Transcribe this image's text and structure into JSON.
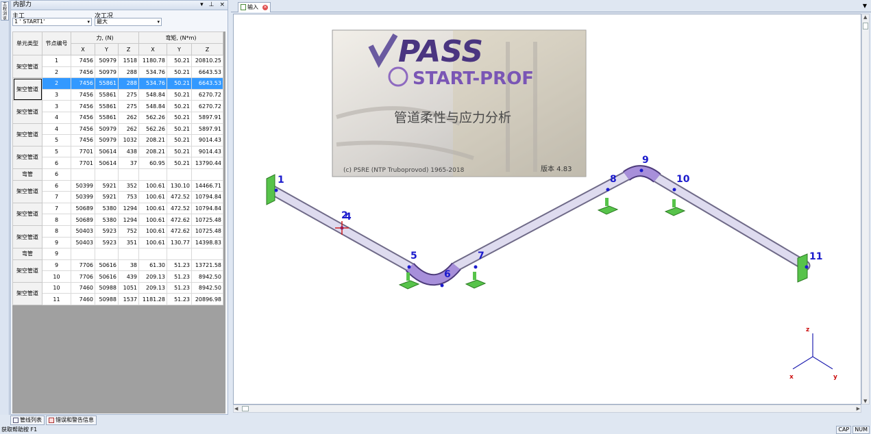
{
  "left_panel": {
    "title": "内部力",
    "buttons": [
      "▾",
      "⊥",
      "×"
    ],
    "label_main": "主工",
    "label_sub": "次工况",
    "combo_main": "1 ' START1'",
    "combo_sub": "最大"
  },
  "toolstrip": {
    "label": "工程浏览器"
  },
  "grid": {
    "headers": {
      "type": "单元类型",
      "node": "节点编号",
      "force": "力, (N)",
      "moment": "弯矩, (N*m)",
      "x": "X",
      "y": "Y",
      "z": "Z"
    },
    "groups": [
      {
        "type": "架空管道",
        "rows": [
          [
            "1",
            "7456",
            "50979",
            "1518",
            "1180.78",
            "50.21",
            "20810.25"
          ],
          [
            "2",
            "7456",
            "50979",
            "288",
            "534.76",
            "50.21",
            "6643.53"
          ]
        ]
      },
      {
        "type": "架空管道",
        "selected": true,
        "rows": [
          [
            "2",
            "7456",
            "55861",
            "288",
            "534.76",
            "50.21",
            "6643.53"
          ],
          [
            "3",
            "7456",
            "55861",
            "275",
            "548.84",
            "50.21",
            "6270.72"
          ]
        ]
      },
      {
        "type": "架空管道",
        "rows": [
          [
            "3",
            "7456",
            "55861",
            "275",
            "548.84",
            "50.21",
            "6270.72"
          ],
          [
            "4",
            "7456",
            "55861",
            "262",
            "562.26",
            "50.21",
            "5897.91"
          ]
        ]
      },
      {
        "type": "架空管道",
        "rows": [
          [
            "4",
            "7456",
            "50979",
            "262",
            "562.26",
            "50.21",
            "5897.91"
          ],
          [
            "5",
            "7456",
            "50979",
            "1032",
            "208.21",
            "50.21",
            "9014.43"
          ]
        ]
      },
      {
        "type": "架空管道",
        "rows": [
          [
            "5",
            "7701",
            "50614",
            "438",
            "208.21",
            "50.21",
            "9014.43"
          ],
          [
            "6",
            "7701",
            "50614",
            "37",
            "60.95",
            "50.21",
            "13790.44"
          ]
        ]
      },
      {
        "type": "弯管",
        "rows": [
          [
            "6",
            "",
            "",
            "",
            "",
            "",
            ""
          ]
        ]
      },
      {
        "type": "架空管道",
        "rows": [
          [
            "6",
            "50399",
            "5921",
            "352",
            "100.61",
            "130.10",
            "14466.71"
          ],
          [
            "7",
            "50399",
            "5921",
            "753",
            "100.61",
            "472.52",
            "10794.84"
          ]
        ]
      },
      {
        "type": "架空管道",
        "rows": [
          [
            "7",
            "50689",
            "5380",
            "1294",
            "100.61",
            "472.52",
            "10794.84"
          ],
          [
            "8",
            "50689",
            "5380",
            "1294",
            "100.61",
            "472.62",
            "10725.48"
          ]
        ]
      },
      {
        "type": "架空管道",
        "rows": [
          [
            "8",
            "50403",
            "5923",
            "752",
            "100.61",
            "472.62",
            "10725.48"
          ],
          [
            "9",
            "50403",
            "5923",
            "351",
            "100.61",
            "130.77",
            "14398.83"
          ]
        ]
      },
      {
        "type": "弯管",
        "rows": [
          [
            "9",
            "",
            "",
            "",
            "",
            "",
            ""
          ]
        ]
      },
      {
        "type": "架空管道",
        "rows": [
          [
            "9",
            "7706",
            "50616",
            "38",
            "61.30",
            "51.23",
            "13721.58"
          ],
          [
            "10",
            "7706",
            "50616",
            "439",
            "209.13",
            "51.23",
            "8942.50"
          ]
        ]
      },
      {
        "type": "架空管道",
        "rows": [
          [
            "10",
            "7460",
            "50988",
            "1051",
            "209.13",
            "51.23",
            "8942.50"
          ],
          [
            "11",
            "7460",
            "50988",
            "1537",
            "1181.28",
            "51.23",
            "20896.98"
          ]
        ]
      }
    ]
  },
  "bottom_tabs": [
    "管线列表",
    "错误和警告信息"
  ],
  "status": {
    "help": "获取帮助按 F1",
    "cap": "CAP",
    "num": "NUM"
  },
  "doc": {
    "tab_label": "输入",
    "menu_arrow": "▼"
  },
  "splash": {
    "brand": "PASS",
    "product": "START-PROF",
    "subtitle": "管道柔性与应力分析",
    "copyright": "(c) PSRE (NTP Truboprovod) 1965-2018",
    "version": "版本 4.83"
  },
  "nodes": [
    "1",
    "2",
    "4",
    "5",
    "6",
    "7",
    "8",
    "9",
    "10",
    "11"
  ],
  "axes": {
    "x": "x",
    "y": "y",
    "z": "z"
  },
  "colors": {
    "selection": "#3399ff",
    "pipe": "#c9c5de",
    "elbow": "#9b7fd0",
    "support": "#55c24a",
    "node_label": "#1a1acc"
  }
}
